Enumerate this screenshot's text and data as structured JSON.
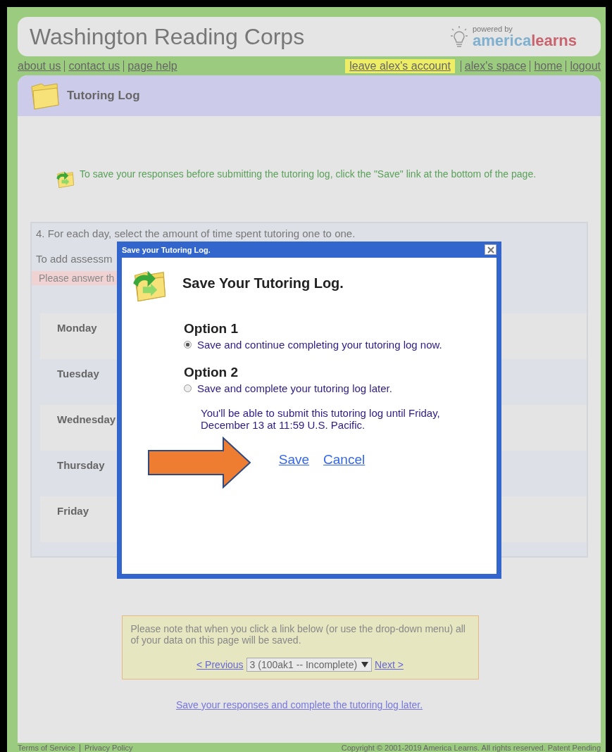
{
  "header": {
    "site_title": "Washington Reading Corps",
    "logo": {
      "tagline": "powered by",
      "brand_part_1": "america",
      "brand_part_2": "learns"
    }
  },
  "nav": {
    "left_links": [
      {
        "label": "about us",
        "highlighted": false
      },
      {
        "label": "contact us",
        "highlighted": false
      },
      {
        "label": "page help",
        "highlighted": false
      }
    ],
    "right_links": [
      {
        "label": "leave alex's account",
        "highlighted": true
      },
      {
        "label": "alex's space",
        "highlighted": false
      },
      {
        "label": "home",
        "highlighted": false
      },
      {
        "label": "logout",
        "highlighted": false
      }
    ]
  },
  "page_title": "Tutoring Log",
  "save_hint": "To save your responses before submitting the tutoring log, click the \"Save\" link at the bottom of the page.",
  "question": {
    "prompt": "4. For each day, select the amount of time spent tutoring one to one.",
    "instruction": "To add assessm",
    "warning": "Please answer th",
    "days": [
      "Monday",
      "Tuesday",
      "Wednesday",
      "Thursday",
      "Friday"
    ]
  },
  "dialog": {
    "title": "Save your Tutoring Log.",
    "heading": "Save Your Tutoring Log.",
    "options": [
      {
        "heading": "Option 1",
        "label": "Save and continue completing your tutoring log now.",
        "selected": true
      },
      {
        "heading": "Option 2",
        "label": "Save and complete your tutoring log later.",
        "selected": false,
        "note": "You'll be able to submit this tutoring log until Friday, December 13 at 11:59 U.S. Pacific."
      }
    ],
    "actions": [
      "Save",
      "Cancel"
    ]
  },
  "pager": {
    "notice": "Please note that when you click a link below (or use the drop-down menu) all of your data on this page will be saved.",
    "previous": "< Previous",
    "current": "3 (100ak1 -- Incomplete)",
    "next": "Next >"
  },
  "save_later_link": "Save your responses and complete the tutoring log later.",
  "footer": {
    "left_links": [
      "Terms of Service",
      "Privacy Policy"
    ],
    "copyright": "Copyright © 2001-2019 America Learns. All rights reserved. Patent Pending"
  }
}
